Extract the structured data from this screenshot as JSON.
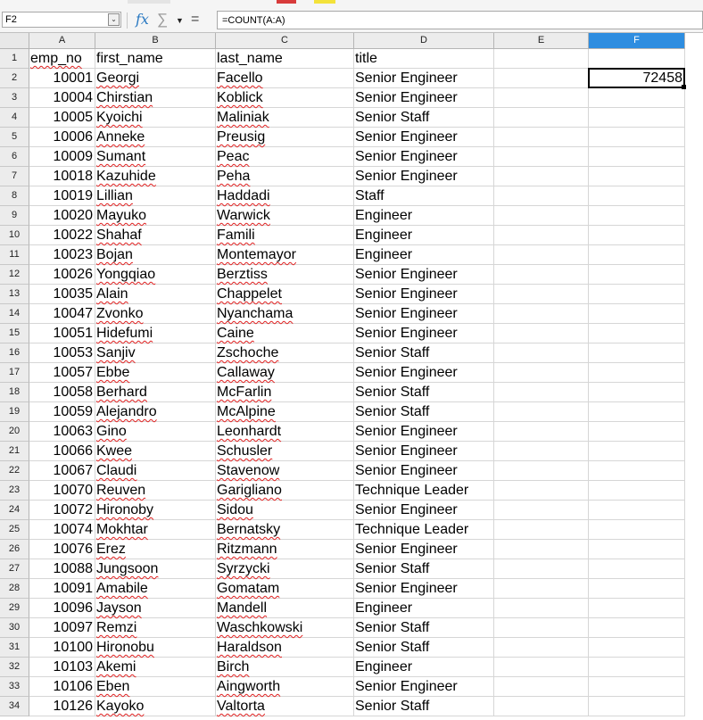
{
  "formula_bar": {
    "name_box": "F2",
    "formula": "=COUNT(A:A)"
  },
  "colors": {
    "selection_accent": "#2e8de0",
    "spellcheck_underline": "#e02020",
    "function_wizard": "#2a79c2"
  },
  "icons": {
    "function_wizard": "fx-icon",
    "sum": "sum-icon",
    "dropdown": "triangle-down-icon",
    "equals": "equals-icon"
  },
  "sheet": {
    "columns": [
      "A",
      "B",
      "C",
      "D",
      "E",
      "F"
    ],
    "active_cell": "F2",
    "active_value": "72458",
    "header_row": [
      "emp_no",
      "first_name",
      "last_name",
      "title"
    ],
    "rows": [
      [
        "10001",
        "Georgi",
        "Facello",
        "Senior Engineer"
      ],
      [
        "10004",
        "Chirstian",
        "Koblick",
        "Senior Engineer"
      ],
      [
        "10005",
        "Kyoichi",
        "Maliniak",
        "Senior Staff"
      ],
      [
        "10006",
        "Anneke",
        "Preusig",
        "Senior Engineer"
      ],
      [
        "10009",
        "Sumant",
        "Peac",
        "Senior Engineer"
      ],
      [
        "10018",
        "Kazuhide",
        "Peha",
        "Senior Engineer"
      ],
      [
        "10019",
        "Lillian",
        "Haddadi",
        "Staff"
      ],
      [
        "10020",
        "Mayuko",
        "Warwick",
        "Engineer"
      ],
      [
        "10022",
        "Shahaf",
        "Famili",
        "Engineer"
      ],
      [
        "10023",
        "Bojan",
        "Montemayor",
        "Engineer"
      ],
      [
        "10026",
        "Yongqiao",
        "Berztiss",
        "Senior Engineer"
      ],
      [
        "10035",
        "Alain",
        "Chappelet",
        "Senior Engineer"
      ],
      [
        "10047",
        "Zvonko",
        "Nyanchama",
        "Senior Engineer"
      ],
      [
        "10051",
        "Hidefumi",
        "Caine",
        "Senior Engineer"
      ],
      [
        "10053",
        "Sanjiv",
        "Zschoche",
        "Senior Staff"
      ],
      [
        "10057",
        "Ebbe",
        "Callaway",
        "Senior Engineer"
      ],
      [
        "10058",
        "Berhard",
        "McFarlin",
        "Senior Staff"
      ],
      [
        "10059",
        "Alejandro",
        "McAlpine",
        "Senior Staff"
      ],
      [
        "10063",
        "Gino",
        "Leonhardt",
        "Senior Engineer"
      ],
      [
        "10066",
        "Kwee",
        "Schusler",
        "Senior Engineer"
      ],
      [
        "10067",
        "Claudi",
        "Stavenow",
        "Senior Engineer"
      ],
      [
        "10070",
        "Reuven",
        "Garigliano",
        "Technique Leader"
      ],
      [
        "10072",
        "Hironoby",
        "Sidou",
        "Senior Engineer"
      ],
      [
        "10074",
        "Mokhtar",
        "Bernatsky",
        "Technique Leader"
      ],
      [
        "10076",
        "Erez",
        "Ritzmann",
        "Senior Engineer"
      ],
      [
        "10088",
        "Jungsoon",
        "Syrzycki",
        "Senior Staff"
      ],
      [
        "10091",
        "Amabile",
        "Gomatam",
        "Senior Engineer"
      ],
      [
        "10096",
        "Jayson",
        "Mandell",
        "Engineer"
      ],
      [
        "10097",
        "Remzi",
        "Waschkowski",
        "Senior Staff"
      ],
      [
        "10100",
        "Hironobu",
        "Haraldson",
        "Senior Staff"
      ],
      [
        "10103",
        "Akemi",
        "Birch",
        "Engineer"
      ],
      [
        "10106",
        "Eben",
        "Aingworth",
        "Senior Engineer"
      ],
      [
        "10126",
        "Kayoko",
        "Valtorta",
        "Senior Staff"
      ]
    ]
  }
}
